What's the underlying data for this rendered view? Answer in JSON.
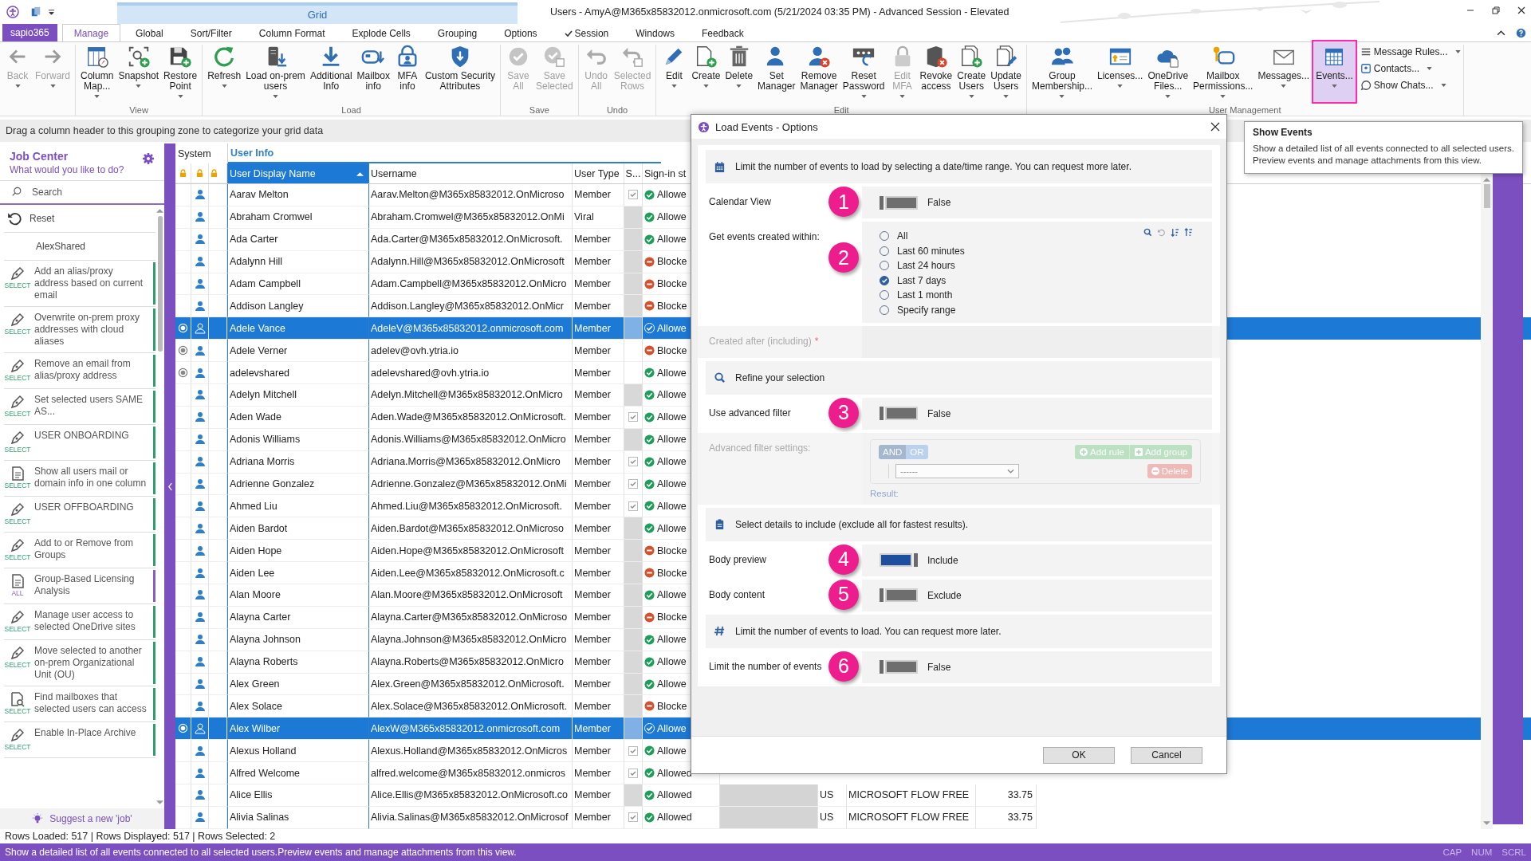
{
  "title_bar": {
    "context_tab": "Grid",
    "title": "Users - AmyA@M365x85832012.onmicrosoft.com (5/21/2024 03:35 PM) - Advanced Session - Elevated"
  },
  "ribbon_tabs": {
    "app_button": "sapio365",
    "tabs": [
      {
        "label": "Manage",
        "selected": true,
        "checked": false
      },
      {
        "label": "Global",
        "selected": false,
        "checked": false
      },
      {
        "label": "Sort/Filter",
        "selected": false,
        "checked": false
      },
      {
        "label": "Column Format",
        "selected": false,
        "checked": false
      },
      {
        "label": "Explode Cells",
        "selected": false,
        "checked": false
      },
      {
        "label": "Grouping",
        "selected": false,
        "checked": false
      },
      {
        "label": "Options",
        "selected": false,
        "checked": false
      },
      {
        "label": "Session",
        "selected": false,
        "checked": true
      },
      {
        "label": "Windows",
        "selected": false,
        "checked": false
      },
      {
        "label": "Feedback",
        "selected": false,
        "checked": false
      }
    ]
  },
  "ribbon": {
    "groups": [
      {
        "buttons": [
          {
            "label": "Back",
            "dropdown": true,
            "disabled": true,
            "highlighted": false
          },
          {
            "label": "Forward",
            "dropdown": true,
            "disabled": true,
            "highlighted": false
          }
        ]
      },
      {
        "label": "View",
        "buttons": [
          {
            "label": "Column\nMap...",
            "dropdown": true,
            "disabled": false,
            "highlighted": false
          },
          {
            "label": "Snapshot",
            "dropdown": true,
            "disabled": false,
            "highlighted": false
          },
          {
            "label": "Restore\nPoint",
            "dropdown": true,
            "disabled": false,
            "highlighted": false
          }
        ]
      },
      {
        "label": "Load",
        "buttons": [
          {
            "label": "Refresh",
            "dropdown": true,
            "disabled": false,
            "highlighted": false
          },
          {
            "label": "Load on-prem\nusers",
            "dropdown": true,
            "disabled": false,
            "highlighted": false
          },
          {
            "label": "Additional\nInfo",
            "dropdown": false,
            "disabled": false,
            "highlighted": false
          },
          {
            "label": "Mailbox\ninfo",
            "dropdown": false,
            "disabled": false,
            "highlighted": false
          },
          {
            "label": "MFA\ninfo",
            "dropdown": false,
            "disabled": false,
            "highlighted": false
          },
          {
            "label": "Custom Security\nAttributes",
            "dropdown": false,
            "disabled": false,
            "highlighted": false
          }
        ]
      },
      {
        "label": "Save",
        "buttons": [
          {
            "label": "Save\nAll",
            "dropdown": false,
            "disabled": true,
            "highlighted": false
          },
          {
            "label": "Save\nSelected",
            "dropdown": false,
            "disabled": true,
            "highlighted": false
          }
        ]
      },
      {
        "label": "Undo",
        "buttons": [
          {
            "label": "Undo\nAll",
            "dropdown": false,
            "disabled": true,
            "highlighted": false
          },
          {
            "label": "Selected\nRows",
            "dropdown": false,
            "disabled": true,
            "highlighted": false
          }
        ]
      },
      {
        "label": "Edit",
        "buttons": [
          {
            "label": "Edit",
            "dropdown": true,
            "disabled": false,
            "highlighted": false
          },
          {
            "label": "Create",
            "dropdown": true,
            "disabled": false,
            "highlighted": false
          },
          {
            "label": "Delete",
            "dropdown": true,
            "disabled": false,
            "highlighted": false
          },
          {
            "label": "Set\nManager",
            "dropdown": false,
            "disabled": false,
            "highlighted": false
          },
          {
            "label": "Remove\nManager",
            "dropdown": false,
            "disabled": false,
            "highlighted": false
          },
          {
            "label": "Reset\nPassword",
            "dropdown": true,
            "disabled": false,
            "highlighted": false
          },
          {
            "label": "Edit\nMFA",
            "dropdown": true,
            "disabled": true,
            "highlighted": false
          },
          {
            "label": "Revoke\naccess",
            "dropdown": false,
            "disabled": false,
            "highlighted": false
          },
          {
            "label": "Create\nUsers",
            "dropdown": true,
            "disabled": false,
            "highlighted": false
          },
          {
            "label": "Update\nUsers",
            "dropdown": true,
            "disabled": false,
            "highlighted": false
          }
        ]
      },
      {
        "label": "User Management",
        "buttons": [
          {
            "label": "Group\nMembership...",
            "dropdown": true,
            "disabled": false,
            "highlighted": false
          },
          {
            "label": "Licenses...",
            "dropdown": true,
            "disabled": false,
            "highlighted": false
          },
          {
            "label": "OneDrive\nFiles...",
            "dropdown": true,
            "disabled": false,
            "highlighted": false
          },
          {
            "label": "Mailbox\nPermissions...",
            "dropdown": true,
            "disabled": false,
            "highlighted": false
          },
          {
            "label": "Messages...",
            "dropdown": true,
            "disabled": false,
            "highlighted": false
          },
          {
            "label": "Events...",
            "dropdown": true,
            "disabled": false,
            "highlighted": true
          }
        ],
        "small_buttons": [
          {
            "label": "Message Rules...",
            "dropdown": true
          },
          {
            "label": "Contacts...",
            "dropdown": true
          },
          {
            "label": "Show Chats...",
            "dropdown": true
          }
        ]
      }
    ]
  },
  "tooltip": {
    "title": "Show Events",
    "text": "Show a detailed list of all events connected to all selected users.\nPreview events and manage attachments from this view."
  },
  "grouping_zone": "Drag a column header to this grouping zone to categorize your grid data",
  "job_center": {
    "title": "Job Center",
    "subtitle": "What would you like to do?",
    "search": {
      "placeholder": "Search"
    },
    "reset": "Reset",
    "shared": "AlexShared",
    "jobs": [
      {
        "text": "Add an alias/proxy address based on current email",
        "tag": "SELECT",
        "color": "#2e9e6e",
        "kind": "pen"
      },
      {
        "text": "Overwrite on-prem proxy addresses with cloud aliases",
        "tag": "SELECT",
        "color": "#2e9e6e",
        "kind": "pen"
      },
      {
        "text": "Remove an email from alias/proxy address",
        "tag": "SELECT",
        "color": "#2e9e6e",
        "kind": "pen"
      },
      {
        "text": "Set selected users SAME AS...",
        "tag": "SELECT",
        "color": "#2e9e6e",
        "kind": "pen"
      },
      {
        "text": "USER ONBOARDING",
        "tag": "SELECT",
        "color": "#2e9e6e",
        "kind": "pen"
      },
      {
        "text": "Show all users mail or domain info in one column",
        "tag": "SELECT",
        "color": "#2e9e6e",
        "kind": "doc"
      },
      {
        "text": "USER OFFBOARDING",
        "tag": "SELECT",
        "color": "#2e9e6e",
        "kind": "pen"
      },
      {
        "text": "Add to or Remove from Groups",
        "tag": "SELECT",
        "color": "#2e9e6e",
        "kind": "pen"
      },
      {
        "text": "Group-Based Licensing Analysis",
        "tag": "ALL",
        "color": "#8a5cc8",
        "kind": "doc"
      },
      {
        "text": "Manage user access to selected OneDrive sites",
        "tag": "SELECT",
        "color": "#2e9e6e",
        "kind": "pen"
      },
      {
        "text": "Move selected to another on-prem Organizational Unit (OU)",
        "tag": "SELECT",
        "color": "#2e9e6e",
        "kind": "pen"
      },
      {
        "text": "Find mailboxes that selected users can access",
        "tag": "SELECT",
        "color": "#2e9e6e",
        "kind": "find"
      },
      {
        "text": "Enable In-Place Archive",
        "tag": "SELECT",
        "color": "#2e9e6e",
        "kind": "pen"
      }
    ],
    "suggest": "Suggest a new 'job'"
  },
  "grid": {
    "bands": [
      {
        "label": "System"
      },
      {
        "label": "User Info"
      }
    ],
    "columns": [
      {
        "label": "User Display Name",
        "selected": true
      },
      {
        "label": "Username",
        "selected": false
      },
      {
        "label": "User Type",
        "selected": false
      },
      {
        "label": "S...",
        "selected": false
      },
      {
        "label": "Sign-in st",
        "selected": false
      }
    ],
    "rows": [
      {
        "name": "Aarav Melton",
        "username": "Aarav.Melton@M365x85832012.OnMicroso",
        "user_type": "Member",
        "s_blank": false,
        "checked": true,
        "sign_in": "Allowe",
        "blocked": false,
        "system": false,
        "selected": false
      },
      {
        "name": "Abraham Cromwel",
        "username": "Abraham.Cromwel@M365x85832012.OnMi",
        "user_type": "Viral",
        "s_blank": false,
        "checked": false,
        "sign_in": "Allowe",
        "blocked": false,
        "system": false,
        "selected": false
      },
      {
        "name": "Ada Carter",
        "username": "Ada.Carter@M365x85832012.OnMicrosoft.",
        "user_type": "Member",
        "s_blank": false,
        "checked": false,
        "sign_in": "Allowe",
        "blocked": false,
        "system": false,
        "selected": false
      },
      {
        "name": "Adalynn Hill",
        "username": "Adalynn.Hill@M365x85832012.OnMicrosoft",
        "user_type": "Member",
        "s_blank": false,
        "checked": false,
        "sign_in": "Blocke",
        "blocked": true,
        "system": false,
        "selected": false
      },
      {
        "name": "Adam Campbell",
        "username": "Adam.Campbell@M365x85832012.OnMicro",
        "user_type": "Member",
        "s_blank": false,
        "checked": false,
        "sign_in": "Blocke",
        "blocked": true,
        "system": false,
        "selected": false
      },
      {
        "name": "Addison Langley",
        "username": "Addison.Langley@M365x85832012.OnMicr",
        "user_type": "Member",
        "s_blank": false,
        "checked": false,
        "sign_in": "Blocke",
        "blocked": true,
        "system": false,
        "selected": false
      },
      {
        "name": "Adele Vance",
        "username": "AdeleV@M365x85832012.onmicrosoft.com",
        "user_type": "Member",
        "s_blank": false,
        "checked": false,
        "sign_in": "Allowe",
        "blocked": false,
        "system": true,
        "selected": true
      },
      {
        "name": "Adele Verner",
        "username": "adelev@ovh.ytria.io",
        "user_type": "Member",
        "s_blank": true,
        "sign_in": "Blocke",
        "blocked": true,
        "system": true,
        "selected": false
      },
      {
        "name": "adelevshared",
        "username": "adelevshared@ovh.ytria.io",
        "user_type": "Member",
        "s_blank": true,
        "sign_in": "Allowe",
        "blocked": false,
        "system": true,
        "selected": false
      },
      {
        "name": "Adelyn Mitchell",
        "username": "Adelyn.Mitchell@M365x85832012.OnMicro",
        "user_type": "Member",
        "s_blank": false,
        "checked": false,
        "sign_in": "Allowe",
        "blocked": false,
        "system": false,
        "selected": false
      },
      {
        "name": "Aden Wade",
        "username": "Aden.Wade@M365x85832012.OnMicrosoft.",
        "user_type": "Member",
        "s_blank": false,
        "checked": true,
        "sign_in": "Allowe",
        "blocked": false,
        "system": false,
        "selected": false
      },
      {
        "name": "Adonis Williams",
        "username": "Adonis.Williams@M365x85832012.OnMicro",
        "user_type": "Member",
        "s_blank": false,
        "checked": false,
        "sign_in": "Allowe",
        "blocked": false,
        "system": false,
        "selected": false
      },
      {
        "name": "Adriana Morris",
        "username": "Adriana.Morris@M365x85832012.OnMicro",
        "user_type": "Member",
        "s_blank": false,
        "checked": true,
        "sign_in": "Allowe",
        "blocked": false,
        "system": false,
        "selected": false
      },
      {
        "name": "Adrienne Gonzalez",
        "username": "Adrienne.Gonzalez@M365x85832012.OnMi",
        "user_type": "Member",
        "s_blank": false,
        "checked": true,
        "sign_in": "Allowe",
        "blocked": false,
        "system": false,
        "selected": false
      },
      {
        "name": "Ahmed Liu",
        "username": "Ahmed.Liu@M365x85832012.OnMicrosoft.",
        "user_type": "Member",
        "s_blank": false,
        "checked": true,
        "sign_in": "Allowe",
        "blocked": false,
        "system": false,
        "selected": false
      },
      {
        "name": "Aiden Bardot",
        "username": "Aiden.Bardot@M365x85832012.OnMicroso",
        "user_type": "Member",
        "s_blank": false,
        "checked": false,
        "sign_in": "Allowe",
        "blocked": false,
        "system": false,
        "selected": false
      },
      {
        "name": "Aiden Hope",
        "username": "Aiden.Hope@M365x85832012.OnMicrosoft",
        "user_type": "Member",
        "s_blank": false,
        "checked": false,
        "sign_in": "Blocke",
        "blocked": true,
        "system": false,
        "selected": false
      },
      {
        "name": "Aiden Lee",
        "username": "Aiden.Lee@M365x85832012.OnMicrosoft.c",
        "user_type": "Member",
        "s_blank": false,
        "checked": false,
        "sign_in": "Blocke",
        "blocked": true,
        "system": false,
        "selected": false
      },
      {
        "name": "Alan Moore",
        "username": "Alan.Moore@M365x85832012.OnMicrosoft",
        "user_type": "Member",
        "s_blank": false,
        "checked": false,
        "sign_in": "Allowe",
        "blocked": false,
        "system": false,
        "selected": false
      },
      {
        "name": "Alayna Carter",
        "username": "Alayna.Carter@M365x85832012.OnMicroso",
        "user_type": "Member",
        "s_blank": false,
        "checked": false,
        "sign_in": "Blocke",
        "blocked": true,
        "system": false,
        "selected": false
      },
      {
        "name": "Alayna Johnson",
        "username": "Alayna.Johnson@M365x85832012.OnMicro",
        "user_type": "Member",
        "s_blank": false,
        "checked": false,
        "sign_in": "Allowe",
        "blocked": false,
        "system": false,
        "selected": false
      },
      {
        "name": "Alayna Roberts",
        "username": "Alayna.Roberts@M365x85832012.OnMicro",
        "user_type": "Member",
        "s_blank": false,
        "checked": false,
        "sign_in": "Allowe",
        "blocked": false,
        "system": false,
        "selected": false
      },
      {
        "name": "Alex Green",
        "username": "Alex.Green@M365x85832012.OnMicrosoft.",
        "user_type": "Member",
        "s_blank": false,
        "checked": false,
        "sign_in": "Allowe",
        "blocked": false,
        "system": false,
        "selected": false
      },
      {
        "name": "Alex Solace",
        "username": "Alex.Solace@M365x85832012.OnMicrosoft.",
        "user_type": "Member",
        "s_blank": false,
        "checked": false,
        "sign_in": "Blocke",
        "blocked": true,
        "system": false,
        "selected": false
      },
      {
        "name": "Alex Wilber",
        "username": "AlexW@M365x85832012.onmicrosoft.com",
        "user_type": "Member",
        "s_blank": false,
        "checked": false,
        "sign_in": "Allowe",
        "blocked": false,
        "system": true,
        "selected": true
      },
      {
        "name": "Alexus Holland",
        "username": "Alexus.Holland@M365x85832012.OnMicros",
        "user_type": "Member",
        "s_blank": false,
        "checked": true,
        "sign_in": "Allowe",
        "blocked": false,
        "system": false,
        "selected": false
      },
      {
        "name": "Alfred Welcome",
        "username": "alfred.welcome@M365x85832012.onmicros",
        "user_type": "Member",
        "s_blank": false,
        "checked": true,
        "sign_in": "Allowed",
        "blocked": false,
        "system": false,
        "selected": false
      },
      {
        "name": "Alice Ellis",
        "username": "Alice.Ellis@M365x85832012.OnMicrosoft.co",
        "user_type": "Member",
        "s_blank": false,
        "checked": false,
        "sign_in": "Allowed",
        "blocked": false,
        "system": false,
        "selected": false,
        "column_9": "US",
        "column_10": "MICROSOFT FLOW FREE",
        "column_11": "33.75"
      },
      {
        "name": "Alivia Salinas",
        "username": "Alivia.Salinas@M365x85832012.OnMicrosof",
        "user_type": "Member",
        "s_blank": false,
        "checked": true,
        "sign_in": "Allowed",
        "blocked": false,
        "system": false,
        "selected": false,
        "column_9": "US",
        "column_10": "MICROSOFT FLOW FREE",
        "column_11": "33.75"
      }
    ]
  },
  "dialog": {
    "title": "Load Events - Options",
    "rows": [
      {
        "kind": "info",
        "text": "Limit the number of events to load by selecting a date/time range. You can request more later."
      },
      {
        "kind": "toggle",
        "label": "Calendar View",
        "callout": "1",
        "on": false,
        "value": "False"
      },
      {
        "kind": "radios",
        "label": "Get events created within:",
        "callout": "2",
        "options": [
          {
            "label": "All",
            "selected": false
          },
          {
            "label": "Last 60 minutes",
            "selected": false
          },
          {
            "label": "Last 24 hours",
            "selected": false
          },
          {
            "label": "Last 7 days",
            "selected": true
          },
          {
            "label": "Last 1 month",
            "selected": false
          },
          {
            "label": "Specify range",
            "selected": false
          }
        ]
      },
      {
        "kind": "date",
        "label": "Created after (including)",
        "required_mark": "*",
        "disabled": true
      },
      {
        "kind": "info",
        "text": "Refine your selection"
      },
      {
        "kind": "toggle",
        "label": "Use advanced filter",
        "callout": "3",
        "on": false,
        "value": "False"
      },
      {
        "kind": "filter",
        "label": "Advanced filter settings:",
        "disabled": true,
        "operators": [
          {
            "label": "AND",
            "selected": true
          },
          {
            "label": "OR",
            "selected": false
          }
        ],
        "add_rule": "Add rule",
        "add_group": "Add group",
        "select_value": "------",
        "delete": "Delete",
        "result_label": "Result:"
      },
      {
        "kind": "info",
        "text": "Select details to include (exclude all for fastest results)."
      },
      {
        "kind": "toggle",
        "label": "Body preview",
        "callout": "4",
        "on": true,
        "value": "Include"
      },
      {
        "kind": "toggle",
        "label": "Body content",
        "callout": "5",
        "on": false,
        "value": "Exclude"
      },
      {
        "kind": "info",
        "text": "Limit the number of events to load. You can request more later."
      },
      {
        "kind": "toggle",
        "label": "Limit the number of events",
        "callout": "6",
        "on": false,
        "value": "False"
      }
    ],
    "buttons": [
      {
        "label": "OK"
      },
      {
        "label": "Cancel"
      }
    ]
  },
  "status_bar": {
    "rows_info": "Rows Loaded: 517 | Rows Displayed: 517 | Rows Selected: 2",
    "message": "Show a detailed list of all events connected to all selected users.Preview events and manage attachments from this view.",
    "indicators": [
      "CAP",
      "NUM",
      "SCRL"
    ]
  }
}
